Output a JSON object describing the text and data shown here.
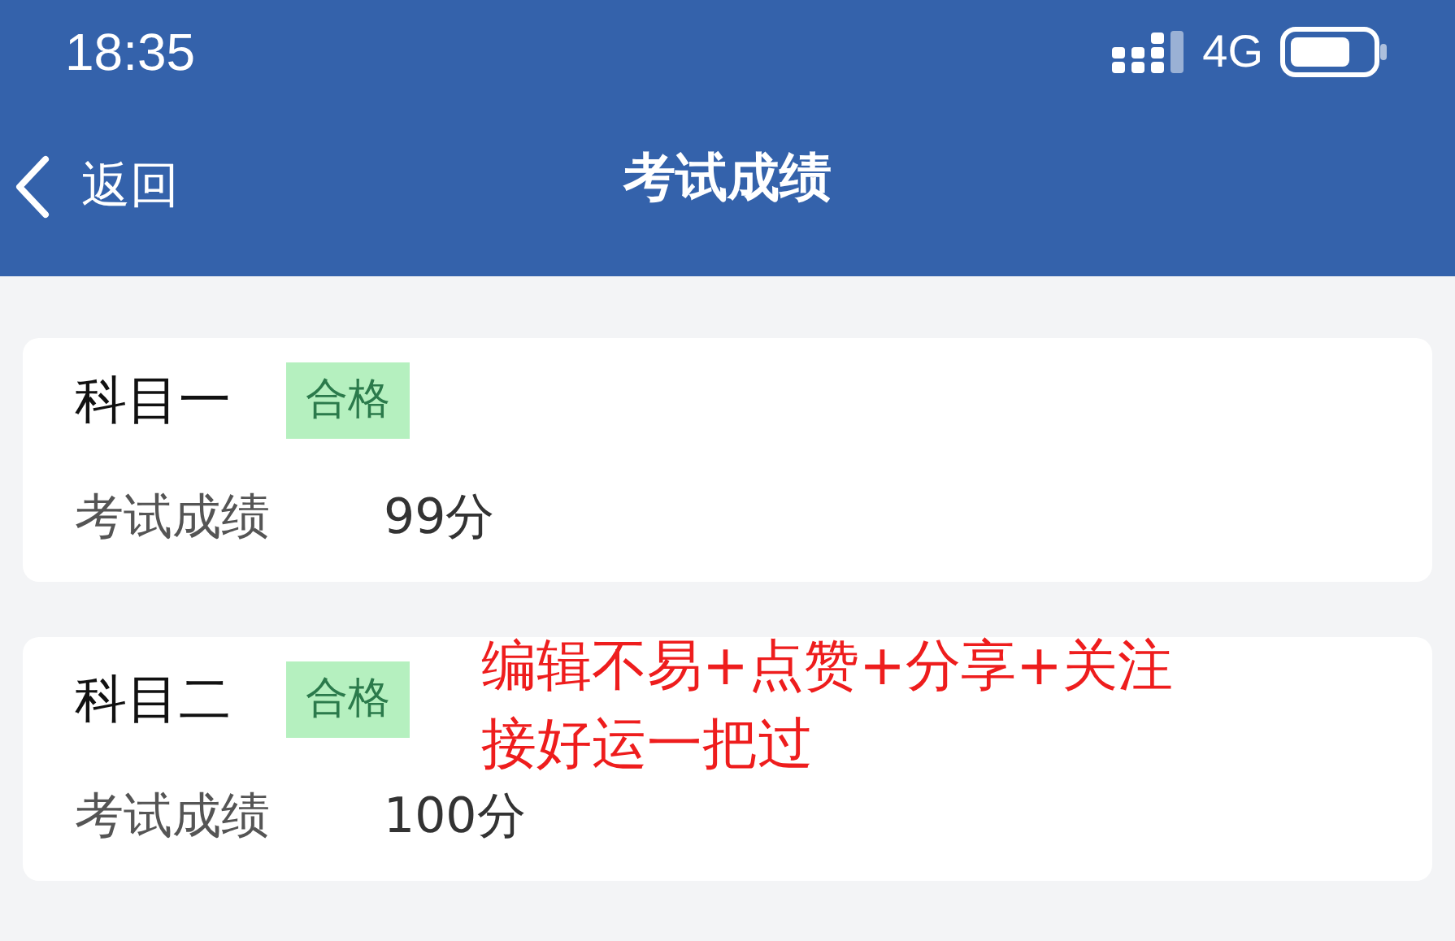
{
  "status_bar": {
    "time": "18:35",
    "network": "4G"
  },
  "nav_bar": {
    "back_label": "返回",
    "title": "考试成绩"
  },
  "results": [
    {
      "subject": "科目一",
      "status": "合格",
      "score_label": "考试成绩",
      "score": "99分"
    },
    {
      "subject": "科目二",
      "status": "合格",
      "score_label": "考试成绩",
      "score": "100分"
    }
  ],
  "overlay_caption": [
    "编辑不易+点赞+分享+关注",
    "接好运一把过"
  ]
}
